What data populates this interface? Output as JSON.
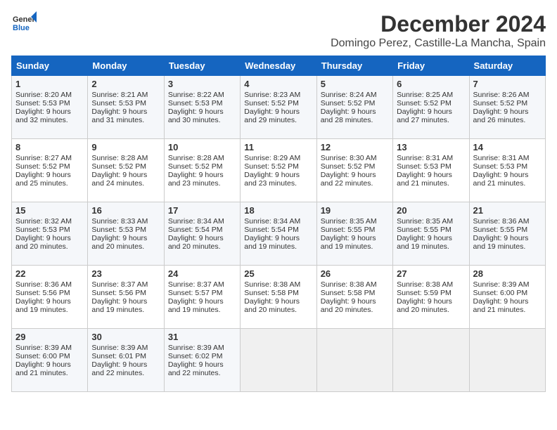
{
  "header": {
    "logo_line1": "General",
    "logo_line2": "Blue",
    "month": "December 2024",
    "location": "Domingo Perez, Castille-La Mancha, Spain"
  },
  "columns": [
    "Sunday",
    "Monday",
    "Tuesday",
    "Wednesday",
    "Thursday",
    "Friday",
    "Saturday"
  ],
  "weeks": [
    [
      {
        "day": "1",
        "info": "Sunrise: 8:20 AM\nSunset: 5:53 PM\nDaylight: 9 hours and 32 minutes."
      },
      {
        "day": "2",
        "info": "Sunrise: 8:21 AM\nSunset: 5:53 PM\nDaylight: 9 hours and 31 minutes."
      },
      {
        "day": "3",
        "info": "Sunrise: 8:22 AM\nSunset: 5:53 PM\nDaylight: 9 hours and 30 minutes."
      },
      {
        "day": "4",
        "info": "Sunrise: 8:23 AM\nSunset: 5:52 PM\nDaylight: 9 hours and 29 minutes."
      },
      {
        "day": "5",
        "info": "Sunrise: 8:24 AM\nSunset: 5:52 PM\nDaylight: 9 hours and 28 minutes."
      },
      {
        "day": "6",
        "info": "Sunrise: 8:25 AM\nSunset: 5:52 PM\nDaylight: 9 hours and 27 minutes."
      },
      {
        "day": "7",
        "info": "Sunrise: 8:26 AM\nSunset: 5:52 PM\nDaylight: 9 hours and 26 minutes."
      }
    ],
    [
      {
        "day": "8",
        "info": "Sunrise: 8:27 AM\nSunset: 5:52 PM\nDaylight: 9 hours and 25 minutes."
      },
      {
        "day": "9",
        "info": "Sunrise: 8:28 AM\nSunset: 5:52 PM\nDaylight: 9 hours and 24 minutes."
      },
      {
        "day": "10",
        "info": "Sunrise: 8:28 AM\nSunset: 5:52 PM\nDaylight: 9 hours and 23 minutes."
      },
      {
        "day": "11",
        "info": "Sunrise: 8:29 AM\nSunset: 5:52 PM\nDaylight: 9 hours and 23 minutes."
      },
      {
        "day": "12",
        "info": "Sunrise: 8:30 AM\nSunset: 5:52 PM\nDaylight: 9 hours and 22 minutes."
      },
      {
        "day": "13",
        "info": "Sunrise: 8:31 AM\nSunset: 5:53 PM\nDaylight: 9 hours and 21 minutes."
      },
      {
        "day": "14",
        "info": "Sunrise: 8:31 AM\nSunset: 5:53 PM\nDaylight: 9 hours and 21 minutes."
      }
    ],
    [
      {
        "day": "15",
        "info": "Sunrise: 8:32 AM\nSunset: 5:53 PM\nDaylight: 9 hours and 20 minutes."
      },
      {
        "day": "16",
        "info": "Sunrise: 8:33 AM\nSunset: 5:53 PM\nDaylight: 9 hours and 20 minutes."
      },
      {
        "day": "17",
        "info": "Sunrise: 8:34 AM\nSunset: 5:54 PM\nDaylight: 9 hours and 20 minutes."
      },
      {
        "day": "18",
        "info": "Sunrise: 8:34 AM\nSunset: 5:54 PM\nDaylight: 9 hours and 19 minutes."
      },
      {
        "day": "19",
        "info": "Sunrise: 8:35 AM\nSunset: 5:55 PM\nDaylight: 9 hours and 19 minutes."
      },
      {
        "day": "20",
        "info": "Sunrise: 8:35 AM\nSunset: 5:55 PM\nDaylight: 9 hours and 19 minutes."
      },
      {
        "day": "21",
        "info": "Sunrise: 8:36 AM\nSunset: 5:55 PM\nDaylight: 9 hours and 19 minutes."
      }
    ],
    [
      {
        "day": "22",
        "info": "Sunrise: 8:36 AM\nSunset: 5:56 PM\nDaylight: 9 hours and 19 minutes."
      },
      {
        "day": "23",
        "info": "Sunrise: 8:37 AM\nSunset: 5:56 PM\nDaylight: 9 hours and 19 minutes."
      },
      {
        "day": "24",
        "info": "Sunrise: 8:37 AM\nSunset: 5:57 PM\nDaylight: 9 hours and 19 minutes."
      },
      {
        "day": "25",
        "info": "Sunrise: 8:38 AM\nSunset: 5:58 PM\nDaylight: 9 hours and 20 minutes."
      },
      {
        "day": "26",
        "info": "Sunrise: 8:38 AM\nSunset: 5:58 PM\nDaylight: 9 hours and 20 minutes."
      },
      {
        "day": "27",
        "info": "Sunrise: 8:38 AM\nSunset: 5:59 PM\nDaylight: 9 hours and 20 minutes."
      },
      {
        "day": "28",
        "info": "Sunrise: 8:39 AM\nSunset: 6:00 PM\nDaylight: 9 hours and 21 minutes."
      }
    ],
    [
      {
        "day": "29",
        "info": "Sunrise: 8:39 AM\nSunset: 6:00 PM\nDaylight: 9 hours and 21 minutes."
      },
      {
        "day": "30",
        "info": "Sunrise: 8:39 AM\nSunset: 6:01 PM\nDaylight: 9 hours and 22 minutes."
      },
      {
        "day": "31",
        "info": "Sunrise: 8:39 AM\nSunset: 6:02 PM\nDaylight: 9 hours and 22 minutes."
      },
      {
        "day": "",
        "info": ""
      },
      {
        "day": "",
        "info": ""
      },
      {
        "day": "",
        "info": ""
      },
      {
        "day": "",
        "info": ""
      }
    ]
  ]
}
